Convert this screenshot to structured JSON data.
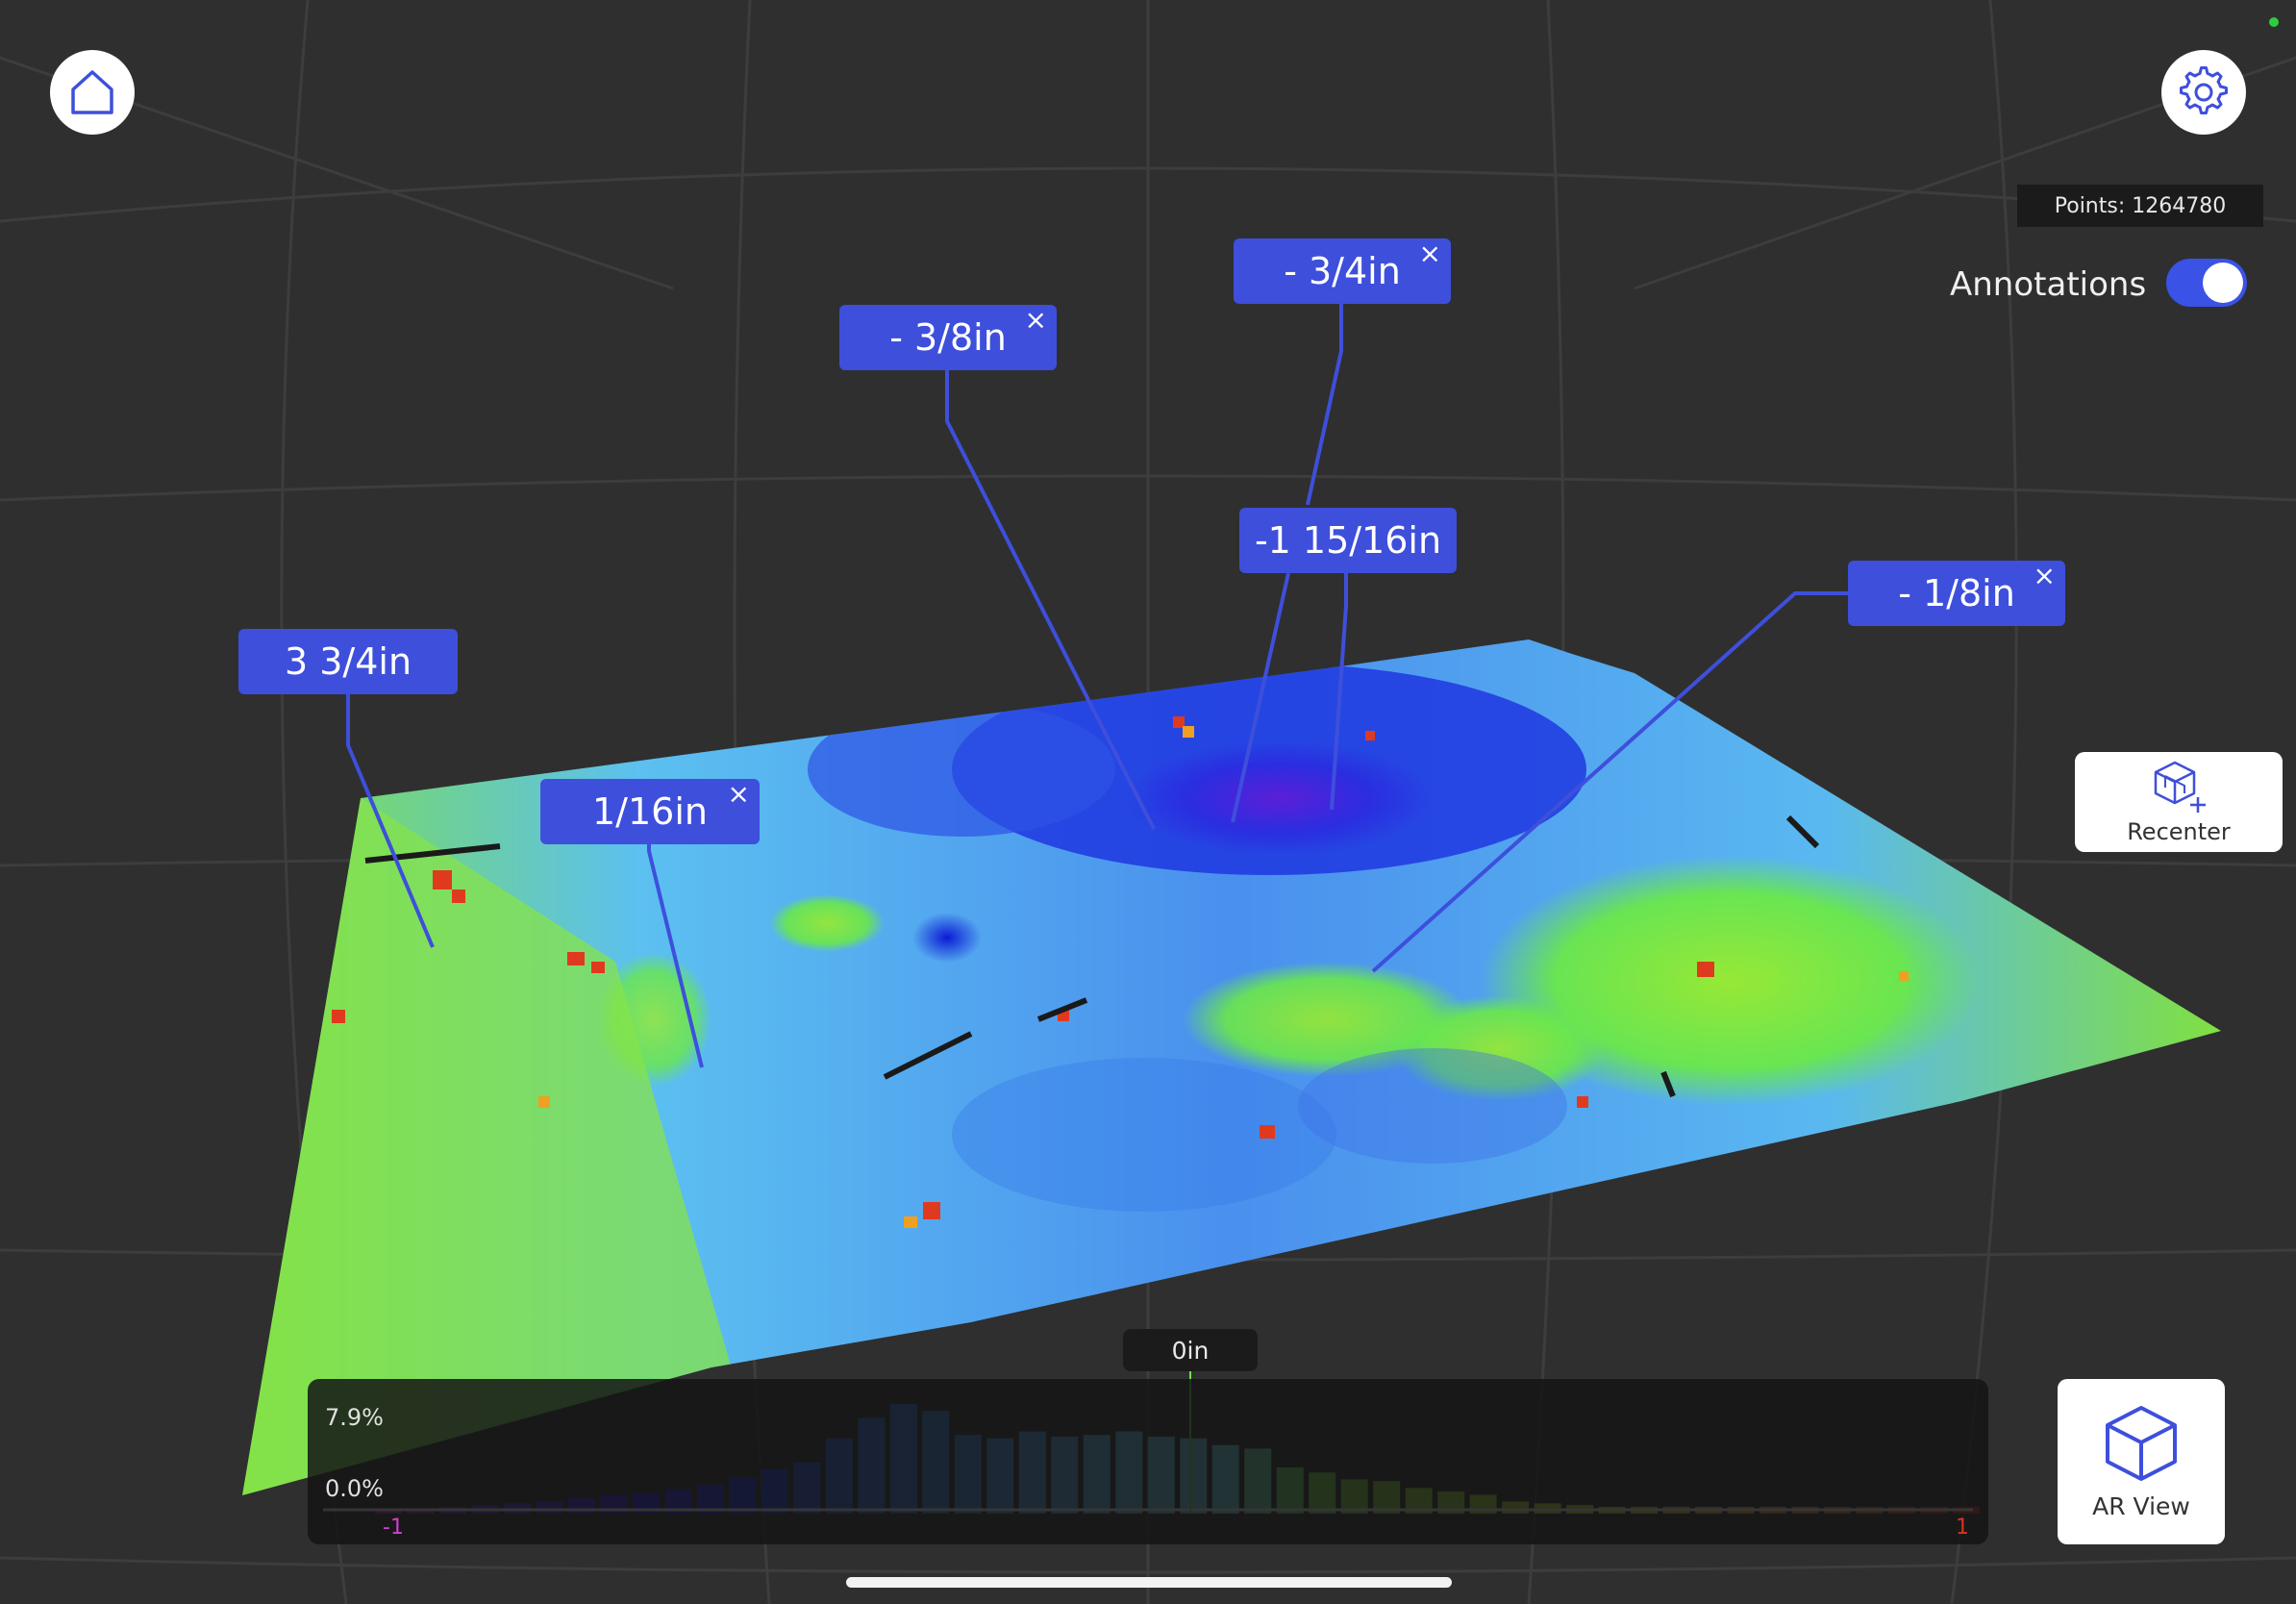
{
  "points_label": "Points: 1264780",
  "annotations_toggle": {
    "label": "Annotations",
    "enabled": true
  },
  "annotations": [
    {
      "label": "3 3/4in",
      "closable": false
    },
    {
      "label": "1/16in",
      "closable": true
    },
    {
      "label": "- 3/8in",
      "closable": true
    },
    {
      "label": "- 3/4in",
      "closable": true
    },
    {
      "label": "-1 15/16in",
      "closable": false
    },
    {
      "label": "- 1/8in",
      "closable": true
    }
  ],
  "close_glyph": "×",
  "buttons": {
    "home_icon": "home-icon",
    "settings_icon": "gear-icon",
    "recenter_label": "Recenter",
    "ar_view_label": "AR View"
  },
  "histogram": {
    "max_label": "7.9%",
    "zero_label": "0.0%",
    "min_tick": "-1",
    "max_tick": "1",
    "center_label": "0in"
  },
  "colors": {
    "accent": "#3e4fdc",
    "toggle_on": "#3a52e6",
    "background": "#2f2f2f"
  }
}
